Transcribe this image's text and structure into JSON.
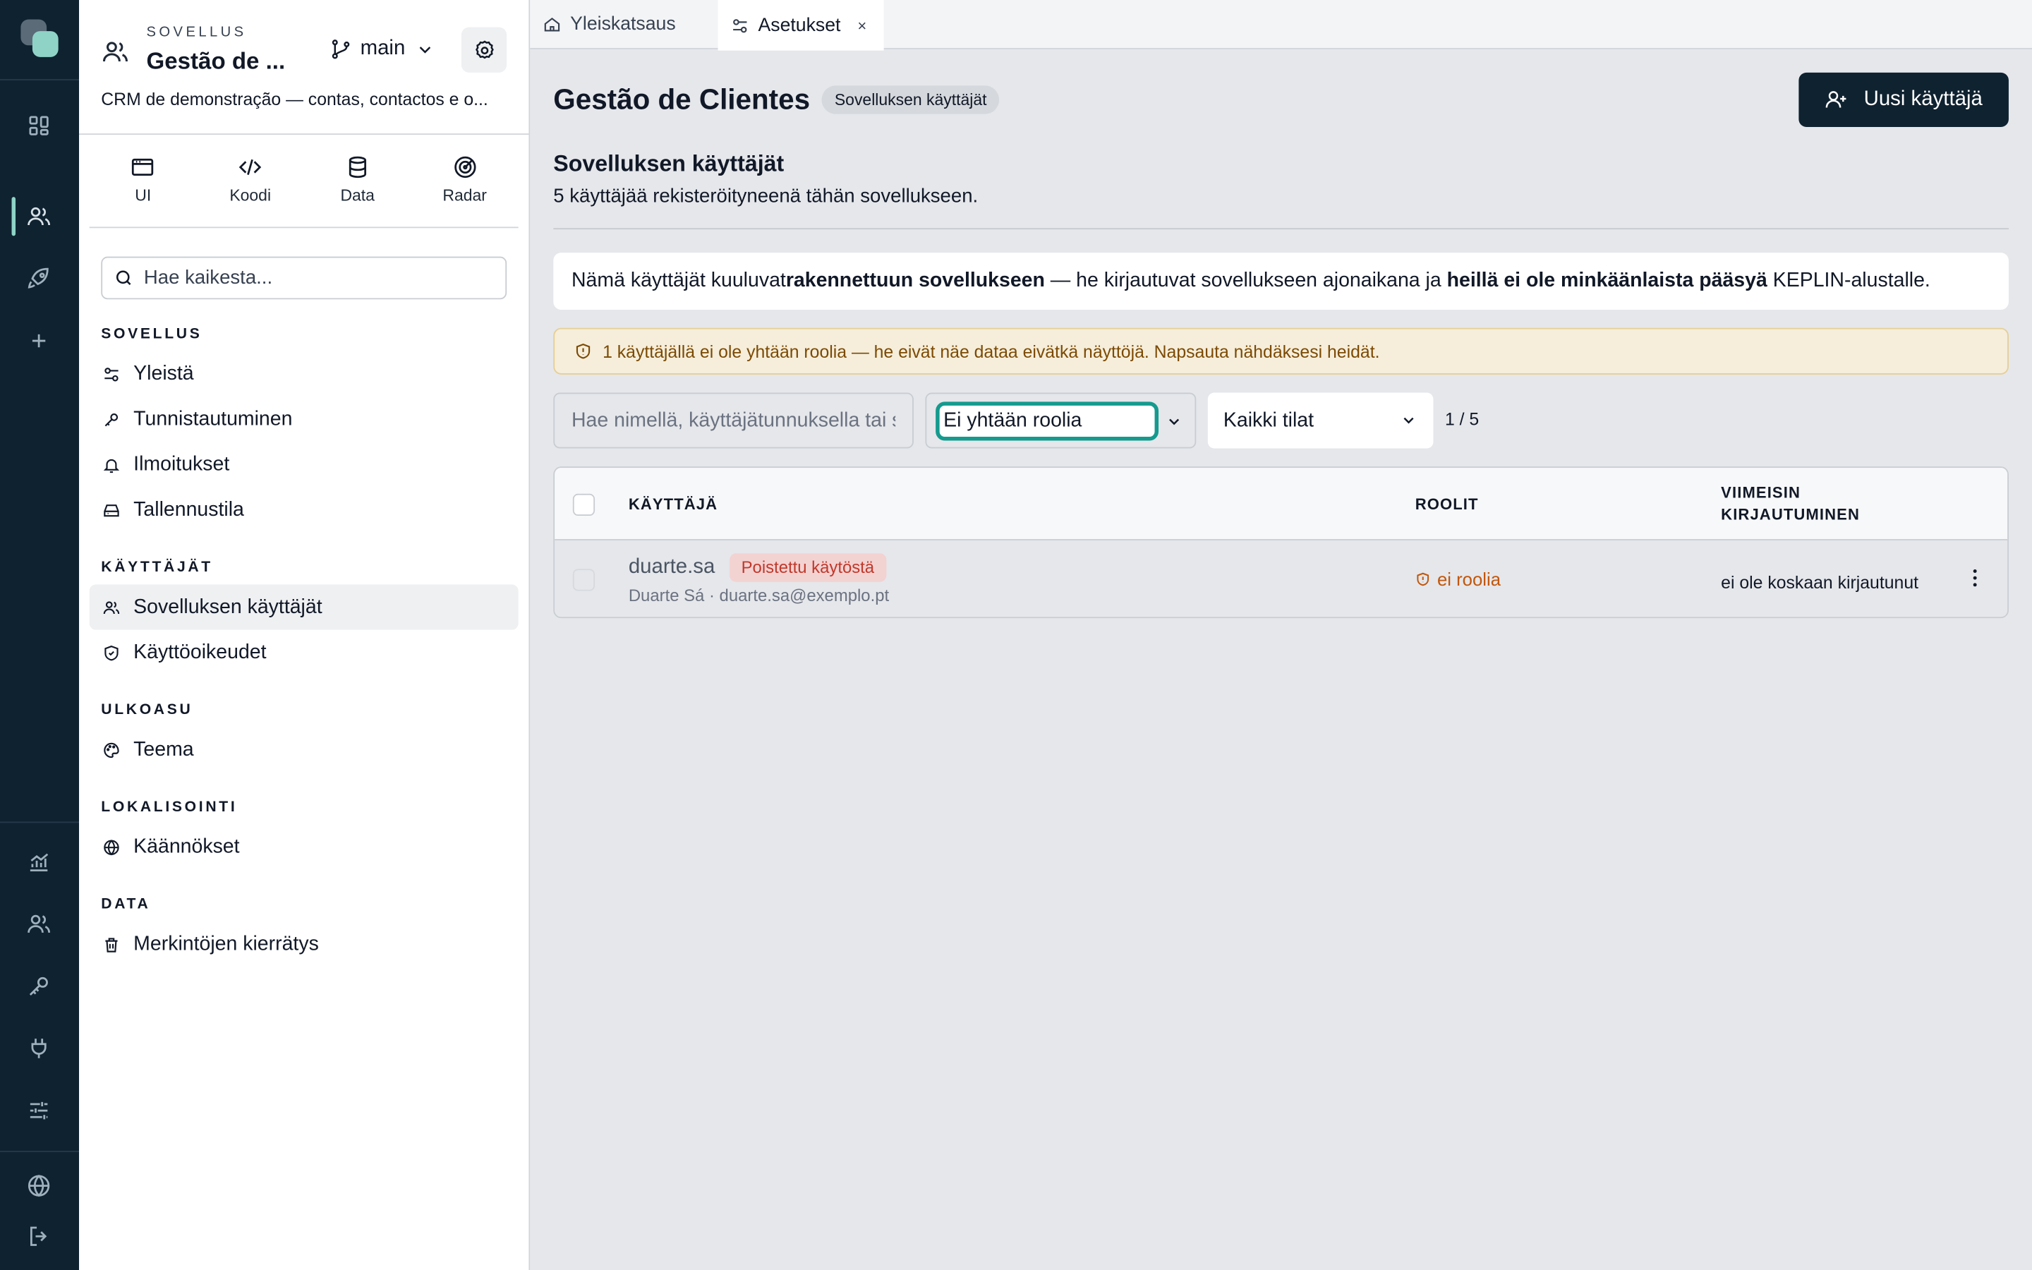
{
  "rail": {
    "icons": [
      "apps-grid-icon",
      "users-icon",
      "rocket-icon",
      "plus-icon",
      "chart-icon",
      "team-icon",
      "key-icon",
      "plug-icon",
      "sliders-icon",
      "globe-icon",
      "logout-icon"
    ],
    "accent": "#8fd3c7",
    "background": "#0f2230"
  },
  "sidebar": {
    "app_kicker": "SOVELLUS",
    "app_name": "Gestão de ...",
    "branch": "main",
    "app_description": "CRM de demonstração — contas, contactos e o...",
    "modes": [
      {
        "label": "UI",
        "icon": "window-icon"
      },
      {
        "label": "Koodi",
        "icon": "code-icon"
      },
      {
        "label": "Data",
        "icon": "database-icon"
      },
      {
        "label": "Radar",
        "icon": "radar-icon"
      }
    ],
    "search_placeholder": "Hae kaikesta...",
    "sections": [
      {
        "title": "SOVELLUS",
        "items": [
          "Yleistä",
          "Tunnistautuminen",
          "Ilmoitukset",
          "Tallennustila"
        ]
      },
      {
        "title": "KÄYTTÄJÄT",
        "items": [
          "Sovelluksen käyttäjät",
          "Käyttöoikeudet"
        ]
      },
      {
        "title": "ULKOASU",
        "items": [
          "Teema"
        ]
      },
      {
        "title": "LOKALISOINTI",
        "items": [
          "Käännökset"
        ]
      },
      {
        "title": "DATA",
        "items": [
          "Merkintöjen kierrätys"
        ]
      }
    ],
    "active_item": "Sovelluksen käyttäjät"
  },
  "tabs": [
    {
      "label": "Yleiskatsaus",
      "active": false
    },
    {
      "label": "Asetukset",
      "active": true,
      "close": "×"
    }
  ],
  "header": {
    "title": "Gestão de Clientes",
    "badge": "Sovelluksen käyttäjät",
    "primary_button": "Uusi käyttäjä"
  },
  "section": {
    "title": "Sovelluksen käyttäjät",
    "description": "5 käyttäjää rekisteröityneenä tähän sovellukseen."
  },
  "info": {
    "part1": "Nämä käyttäjät kuuluvat ",
    "bold1": "rakennettuun sovellukseen",
    "part2": " — he kirjautuvat sovellukseen ajonaikana ja ",
    "bold2": "heillä ei ole minkäänlaista pääsyä",
    "part3": " KEPLIN-alustalle."
  },
  "warning": "1 käyttäjällä ei ole yhtään roolia — he eivät näe dataa eivätkä näyttöjä. Napsauta nähdäksesi heidät.",
  "filters": {
    "search_placeholder": "Hae nimellä, käyttäjätunnuksella tai sähköpostilla",
    "role_filter": "Ei yhtään roolia",
    "status_filter": "Kaikki tilat",
    "count": "1 / 5"
  },
  "table": {
    "columns": [
      "KÄYTTÄJÄ",
      "ROOLIT",
      "VIIMEISIN",
      "KIRJAUTUMINEN"
    ],
    "rows": [
      {
        "username": "duarte.sa",
        "status": "Poistettu käytöstä",
        "meta": "Duarte Sá · duarte.sa@exemplo.pt",
        "roles": "ei roolia",
        "last_login": "ei ole koskaan kirjautunut"
      }
    ]
  }
}
